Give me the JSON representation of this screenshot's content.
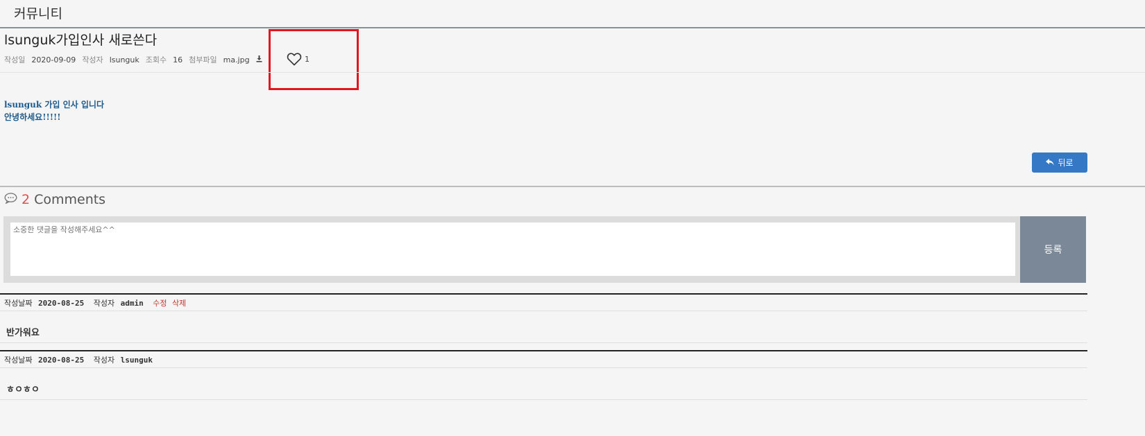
{
  "header": {
    "title": "커뮤니티"
  },
  "post": {
    "title": "lsunguk가입인사 새로쓴다",
    "meta": {
      "date_label": "작성일",
      "date": "2020-09-09",
      "author_label": "작성자",
      "author": "lsunguk",
      "views_label": "조회수",
      "views": "16",
      "attach_label": "첨부파일",
      "attach_file": "ma.jpg"
    },
    "like_count": "1",
    "content_lines": [
      "lsunguk 가입 인사 입니다",
      "안녕하세요!!!!!"
    ],
    "back_label": "뒤로"
  },
  "comments_section": {
    "count": "2",
    "label": "Comments",
    "form": {
      "placeholder": "소중한 댓글을 작성해주세요^^",
      "submit_label": "등록"
    },
    "items": [
      {
        "date_label": "작성날짜",
        "date": "2020-08-25",
        "author_label": "작성자",
        "author": "admin",
        "edit_label": "수정",
        "delete_label": "삭제",
        "body": "반가워요"
      },
      {
        "date_label": "작성날짜",
        "date": "2020-08-25",
        "author_label": "작성자",
        "author": "lsunguk",
        "body": "ㅎㅇㅎㅇ"
      }
    ]
  },
  "colors": {
    "accent_blue": "#3578c6",
    "highlight_red": "#e3141d",
    "comment_count_red": "#d9534f",
    "submit_gray": "#7b8898"
  },
  "icons": [
    "heart-icon",
    "download-icon",
    "reply-icon",
    "comment-bubble-icon"
  ]
}
